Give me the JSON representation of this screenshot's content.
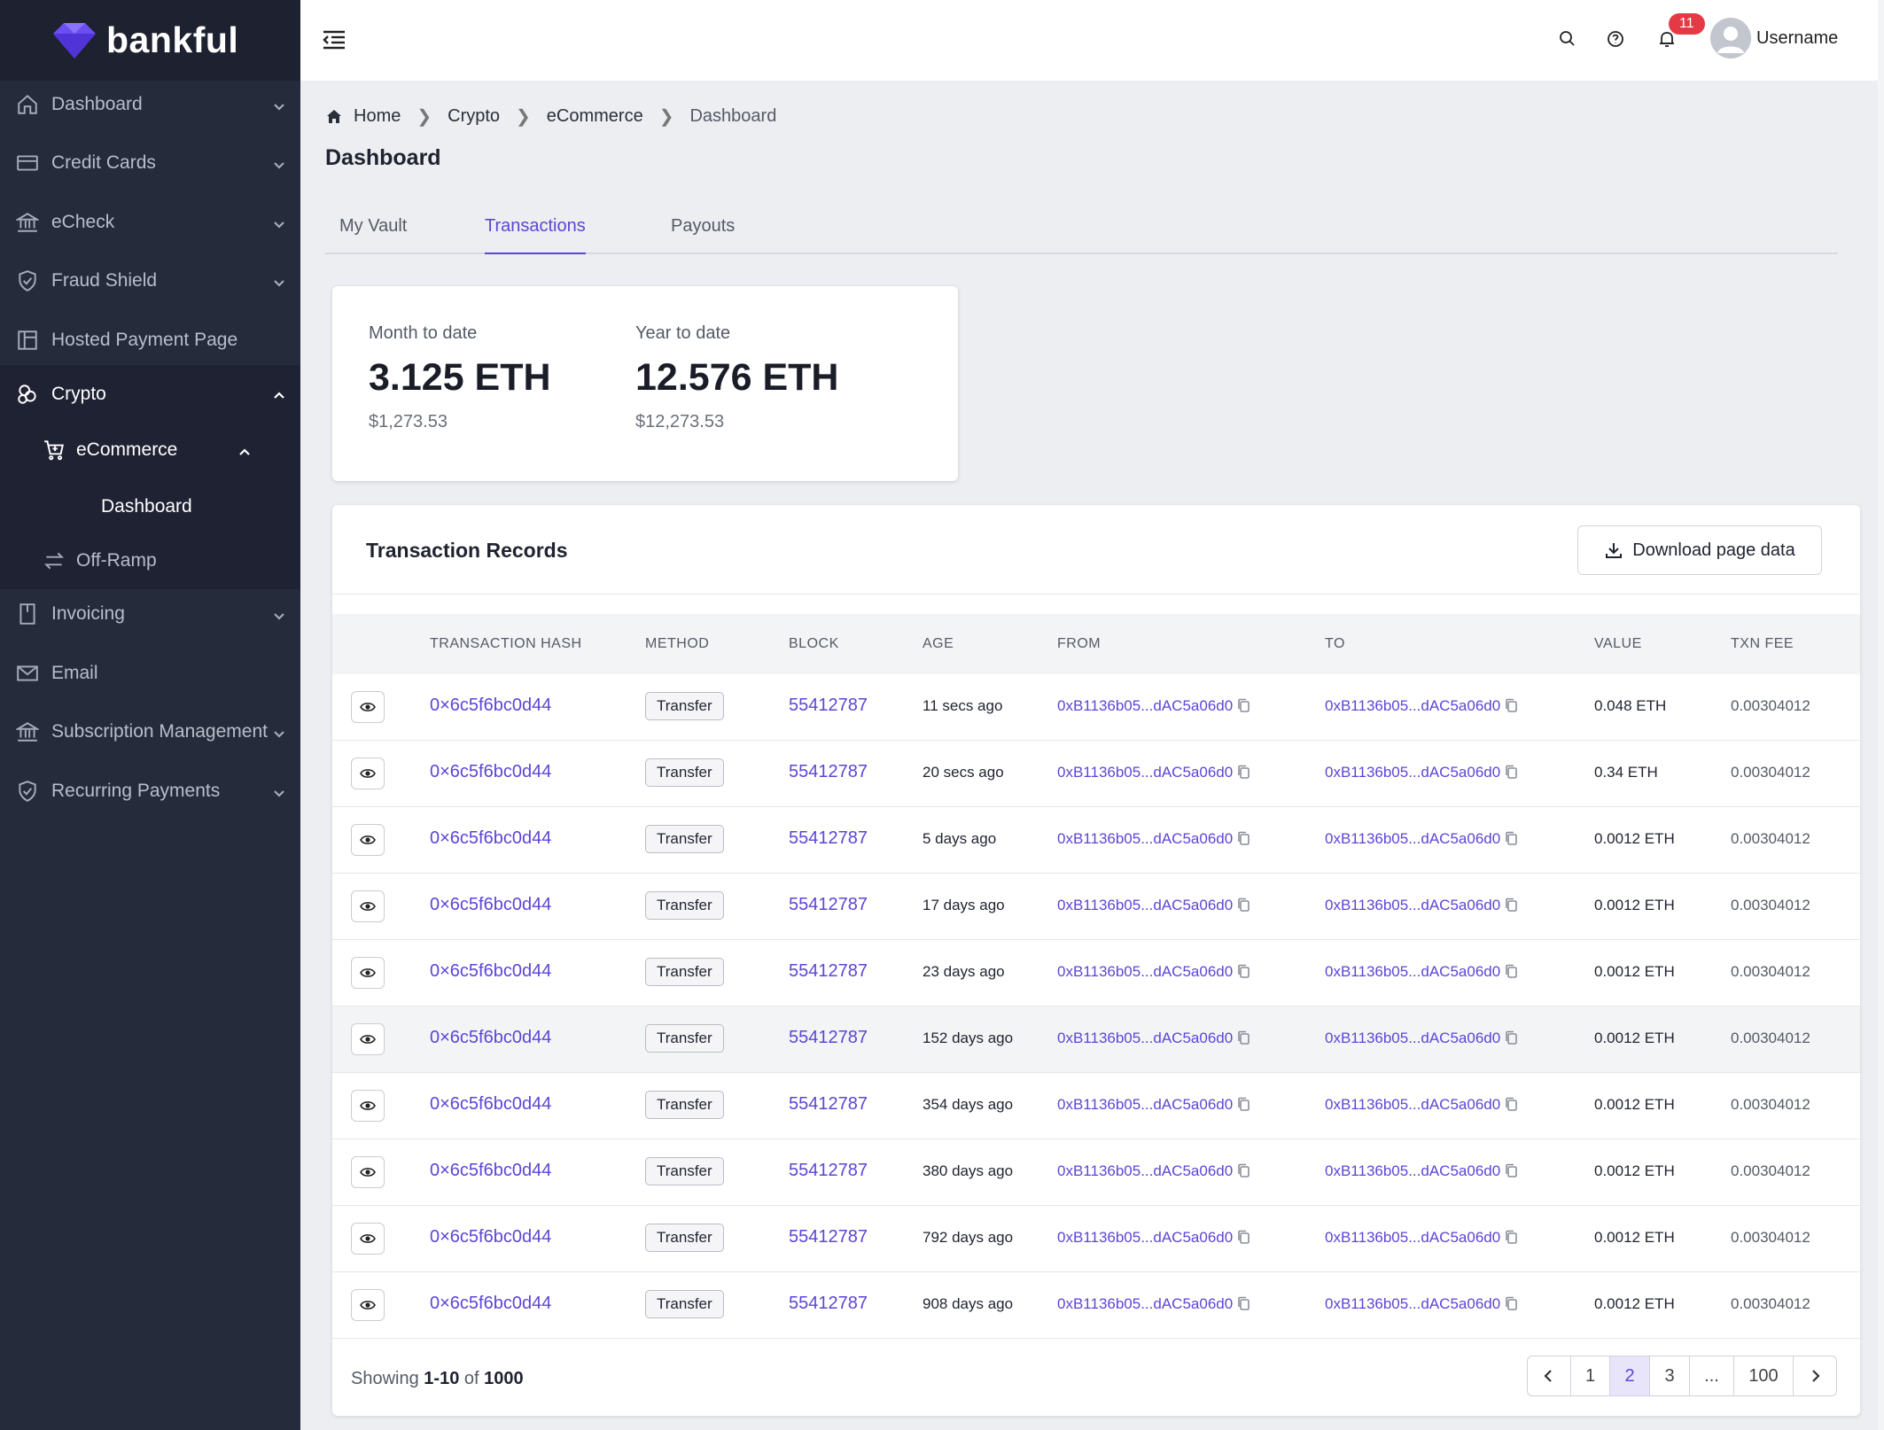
{
  "app": {
    "brand": "bankful"
  },
  "sidebar": {
    "items": [
      {
        "label": "Dashboard",
        "icon": "home-icon"
      },
      {
        "label": "Credit Cards",
        "icon": "credit-card-icon"
      },
      {
        "label": "eCheck",
        "icon": "bank-icon"
      },
      {
        "label": "Fraud Shield",
        "icon": "shield-check-icon"
      },
      {
        "label": "Hosted Payment Page",
        "icon": "layout-icon"
      },
      {
        "label": "Crypto",
        "icon": "coins-icon"
      },
      {
        "label": "Invoicing",
        "icon": "invoice-icon"
      },
      {
        "label": "Email",
        "icon": "mail-icon"
      },
      {
        "label": "Subscription Management",
        "icon": "bank-icon"
      },
      {
        "label": "Recurring Payments",
        "icon": "shield-check-icon"
      }
    ],
    "sub": {
      "ecommerce": "eCommerce",
      "dashboard": "Dashboard",
      "offramp": "Off-Ramp"
    }
  },
  "topbar": {
    "notifications_count": "11",
    "username": "Username"
  },
  "breadcrumb": [
    "Home",
    "Crypto",
    "eCommerce",
    "Dashboard"
  ],
  "page_title": "Dashboard",
  "tabs": [
    "My Vault",
    "Transactions",
    "Payouts"
  ],
  "stats": {
    "mtd": {
      "label": "Month to date",
      "value": "3.125 ETH",
      "usd": "$1,273.53"
    },
    "ytd": {
      "label": "Year to date",
      "value": "12.576 ETH",
      "usd": "$12,273.53"
    }
  },
  "records": {
    "title": "Transaction Records",
    "download_label": "Download page data",
    "columns": [
      "TRANSACTION HASH",
      "METHOD",
      "BLOCK",
      "AGE",
      "FROM",
      "TO",
      "VALUE",
      "TXN FEE"
    ],
    "rows": [
      {
        "hash": "0×6c5f6bc0d44",
        "method": "Transfer",
        "block": "55412787",
        "age": "11 secs ago",
        "from": "0xB1136b05...dAC5a06d0",
        "to": "0xB1136b05...dAC5a06d0",
        "value": "0.048 ETH",
        "fee": "0.00304012"
      },
      {
        "hash": "0×6c5f6bc0d44",
        "method": "Transfer",
        "block": "55412787",
        "age": "20 secs ago",
        "from": "0xB1136b05...dAC5a06d0",
        "to": "0xB1136b05...dAC5a06d0",
        "value": "0.34 ETH",
        "fee": "0.00304012"
      },
      {
        "hash": "0×6c5f6bc0d44",
        "method": "Transfer",
        "block": "55412787",
        "age": "5 days ago",
        "from": "0xB1136b05...dAC5a06d0",
        "to": "0xB1136b05...dAC5a06d0",
        "value": "0.0012 ETH",
        "fee": "0.00304012"
      },
      {
        "hash": "0×6c5f6bc0d44",
        "method": "Transfer",
        "block": "55412787",
        "age": "17 days ago",
        "from": "0xB1136b05...dAC5a06d0",
        "to": "0xB1136b05...dAC5a06d0",
        "value": "0.0012 ETH",
        "fee": "0.00304012"
      },
      {
        "hash": "0×6c5f6bc0d44",
        "method": "Transfer",
        "block": "55412787",
        "age": "23 days ago",
        "from": "0xB1136b05...dAC5a06d0",
        "to": "0xB1136b05...dAC5a06d0",
        "value": "0.0012 ETH",
        "fee": "0.00304012"
      },
      {
        "hash": "0×6c5f6bc0d44",
        "method": "Transfer",
        "block": "55412787",
        "age": "152 days ago",
        "from": "0xB1136b05...dAC5a06d0",
        "to": "0xB1136b05...dAC5a06d0",
        "value": "0.0012 ETH",
        "fee": "0.00304012"
      },
      {
        "hash": "0×6c5f6bc0d44",
        "method": "Transfer",
        "block": "55412787",
        "age": "354 days ago",
        "from": "0xB1136b05...dAC5a06d0",
        "to": "0xB1136b05...dAC5a06d0",
        "value": "0.0012 ETH",
        "fee": "0.00304012"
      },
      {
        "hash": "0×6c5f6bc0d44",
        "method": "Transfer",
        "block": "55412787",
        "age": "380 days ago",
        "from": "0xB1136b05...dAC5a06d0",
        "to": "0xB1136b05...dAC5a06d0",
        "value": "0.0012 ETH",
        "fee": "0.00304012"
      },
      {
        "hash": "0×6c5f6bc0d44",
        "method": "Transfer",
        "block": "55412787",
        "age": "792 days ago",
        "from": "0xB1136b05...dAC5a06d0",
        "to": "0xB1136b05...dAC5a06d0",
        "value": "0.0012 ETH",
        "fee": "0.00304012"
      },
      {
        "hash": "0×6c5f6bc0d44",
        "method": "Transfer",
        "block": "55412787",
        "age": "908 days ago",
        "from": "0xB1136b05...dAC5a06d0",
        "to": "0xB1136b05...dAC5a06d0",
        "value": "0.0012 ETH",
        "fee": "0.00304012"
      }
    ],
    "footer": {
      "showing": "Showing",
      "range": "1-10",
      "of": "of",
      "total": "1000"
    },
    "pagination": {
      "pages": [
        "1",
        "2",
        "3",
        "...",
        "100"
      ],
      "current": "2"
    }
  },
  "colors": {
    "accent": "#5b46d6",
    "sidebar": "#262b3c",
    "badge": "#e53945"
  }
}
